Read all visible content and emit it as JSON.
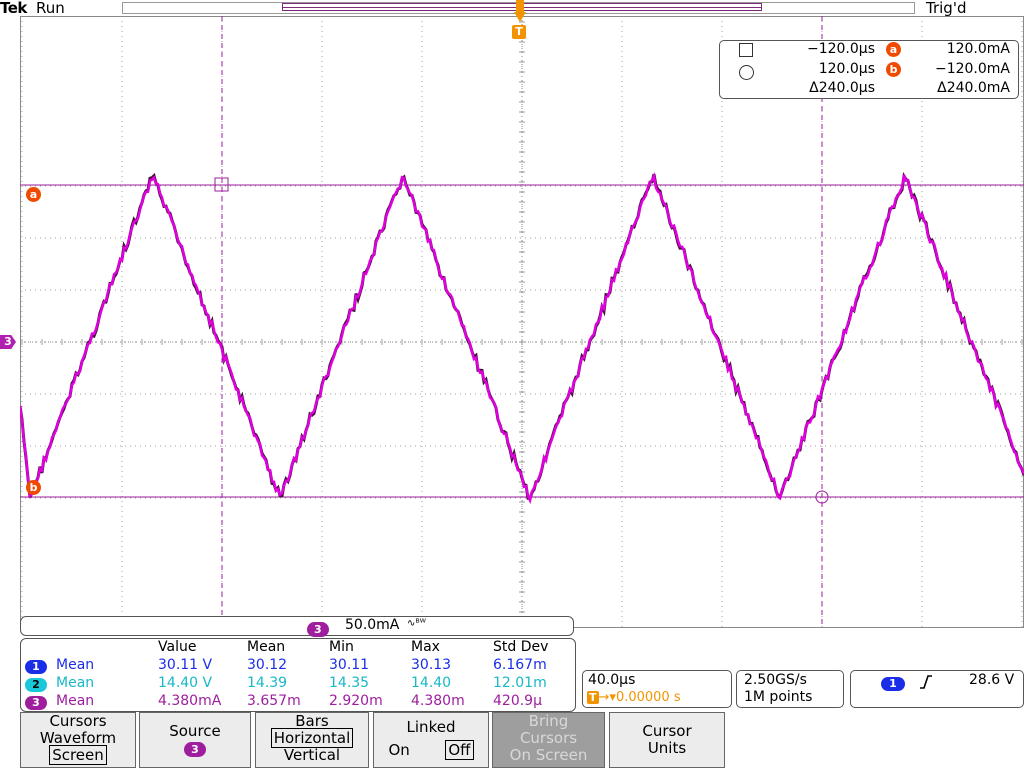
{
  "header": {
    "brand": "Tek",
    "run_state": "Run",
    "trigger_state": "Trig'd"
  },
  "markers": {
    "cursor_a": "a",
    "cursor_b": "b",
    "channel_3": "3",
    "trigger": "T"
  },
  "cursor_readout": {
    "time1": "−120.0µs",
    "time2": "120.0µs",
    "delta_time": "Δ240.0µs",
    "val_a": "120.0mA",
    "val_b": "−120.0mA",
    "delta_val": "Δ240.0mA",
    "label_a": "a",
    "label_b": "b"
  },
  "scale": {
    "channel": "3",
    "value": "50.0mA",
    "bw_symbol": "∿ᴮᵂ"
  },
  "measurements": {
    "headers": [
      "Value",
      "Mean",
      "Min",
      "Max",
      "Std Dev"
    ],
    "rows": [
      {
        "ch": "1",
        "type": "Mean",
        "value": "30.11 V",
        "mean": "30.12",
        "min": "30.11",
        "max": "30.13",
        "std": "6.167m",
        "color": "#1a2ee8"
      },
      {
        "ch": "2",
        "type": "Mean",
        "value": "14.40 V",
        "mean": "14.39",
        "min": "14.35",
        "max": "14.40",
        "std": "12.01m",
        "color": "#18c8d8"
      },
      {
        "ch": "3",
        "type": "Mean",
        "value": "4.380mA",
        "mean": "3.657m",
        "min": "2.920m",
        "max": "4.380m",
        "std": "420.9µ",
        "color": "#9e1e9e"
      }
    ]
  },
  "timebase": {
    "horizontal": "40.0µs",
    "trigger_pos": "0.00000 s"
  },
  "acquisition": {
    "sample_rate": "2.50GS/s",
    "record_length": "1M points"
  },
  "trigger": {
    "source": "1",
    "slope": "rising",
    "level": "28.6 V"
  },
  "softkeys": {
    "cursors_title": "Cursors",
    "cursors_line2": "Waveform",
    "cursors_line3": "Screen",
    "source_title": "Source",
    "source_value": "3",
    "bars_title": "Bars",
    "bars_opt1": "Horizontal",
    "bars_opt2": "Vertical",
    "linked_title": "Linked",
    "linked_on": "On",
    "linked_off": "Off",
    "bring_l1": "Bring",
    "bring_l2": "Cursors",
    "bring_l3": "On Screen",
    "units_l1": "Cursor",
    "units_l2": "Units"
  },
  "colors": {
    "ch1": "#1a2ee8",
    "ch2": "#18c8d8",
    "ch3": "#b020b0",
    "cursor": "#f04a00",
    "trigger": "#f29400"
  }
}
